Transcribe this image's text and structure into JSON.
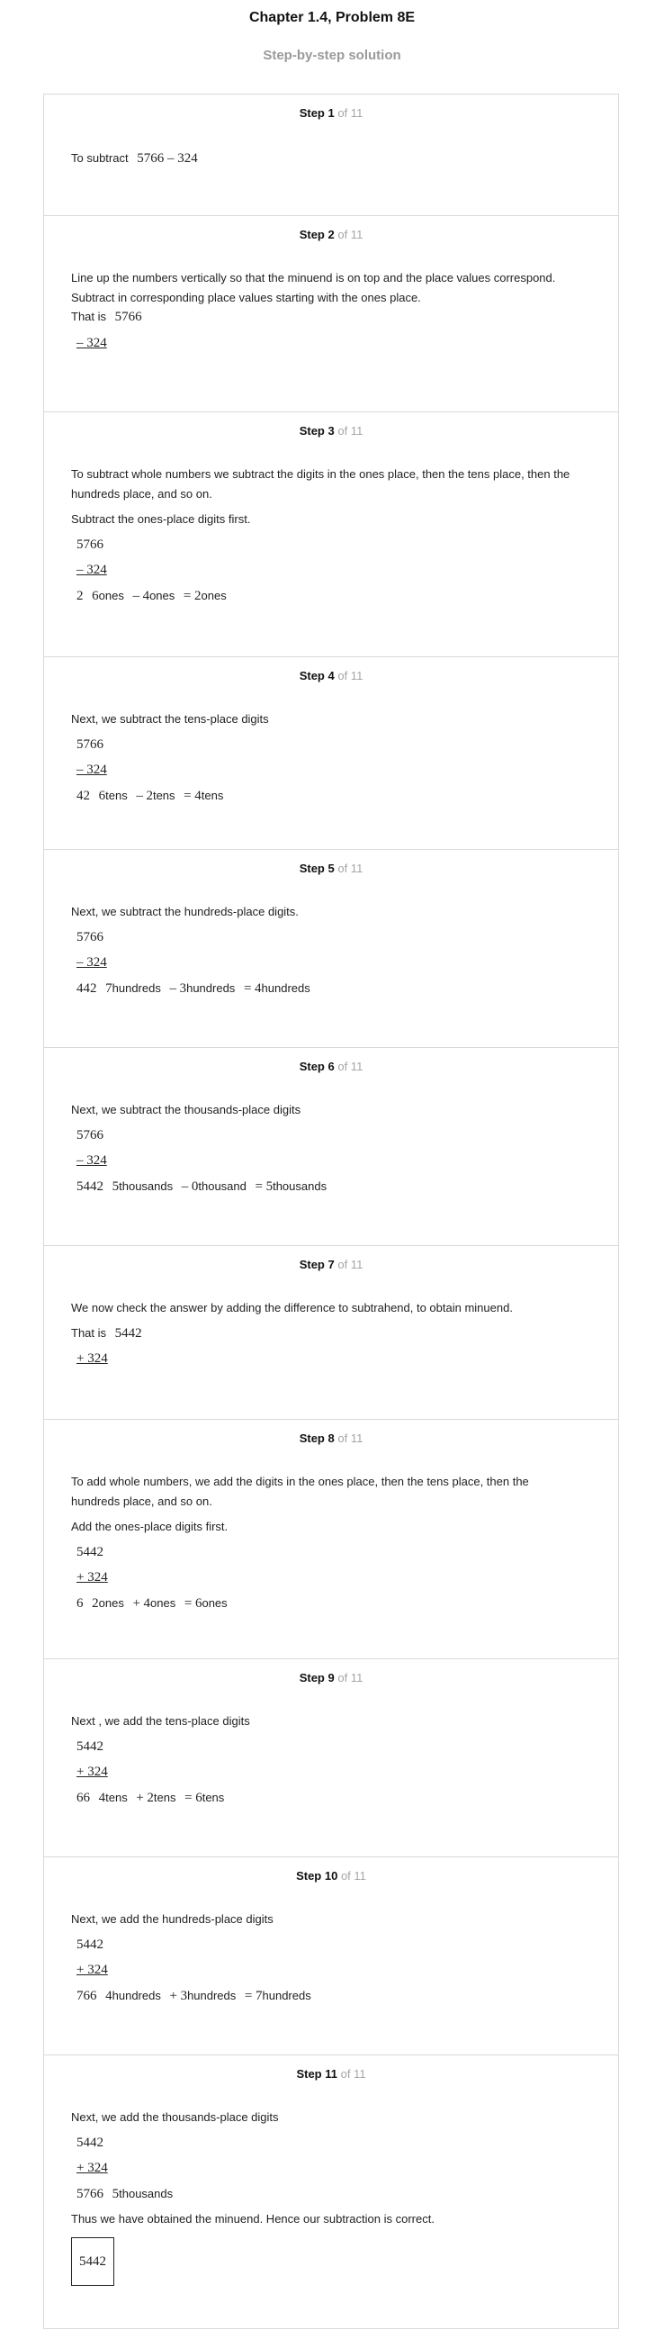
{
  "header": {
    "title": "Chapter 1.4, Problem 8E",
    "subtitle": "Step-by-step solution"
  },
  "steps": [
    {
      "num": "Step 1",
      "of": "of 11",
      "t1": "To subtract",
      "expr": "5766 – 324"
    },
    {
      "num": "Step 2",
      "of": "of 11",
      "t1": "Line up the numbers vertically so that the minuend is on top and the place values correspond. Subtract in corresponding place values starting with the ones place.",
      "t2": "That is",
      "top": "5766",
      "bot": "– 324"
    },
    {
      "num": "Step 3",
      "of": "of 11",
      "t1": "To subtract whole numbers we subtract the digits in the ones place, then the tens place, then the hundreds place, and so on.",
      "t2": "Subtract the ones-place digits first.",
      "top": "5766",
      "bot": "– 324",
      "res": "2",
      "a": "6",
      "au": "ones",
      "op": "–",
      "b": "4",
      "bu": "ones",
      "eq": "=",
      "c": "2",
      "cu": "ones"
    },
    {
      "num": "Step 4",
      "of": "of 11",
      "t1": "Next, we subtract the tens-place digits",
      "top": "5766",
      "bot": "– 324",
      "res": "42",
      "a": "6",
      "au": "tens",
      "op": "–",
      "b": "2",
      "bu": "tens",
      "eq": "=",
      "c": "4",
      "cu": "tens"
    },
    {
      "num": "Step 5",
      "of": "of 11",
      "t1": "Next, we subtract the hundreds-place digits.",
      "top": "5766",
      "bot": "– 324",
      "res": "442",
      "a": "7",
      "au": "hundreds",
      "op": "–",
      "b": "3",
      "bu": "hundreds",
      "eq": "=",
      "c": "4",
      "cu": "hundreds"
    },
    {
      "num": "Step 6",
      "of": "of 11",
      "t1": "Next, we subtract the thousands-place digits",
      "top": "5766",
      "bot": "– 324",
      "res": "5442",
      "a": "5",
      "au": "thousands",
      "op": "–",
      "b": "0",
      "bu": "thousand",
      "eq": "=",
      "c": "5",
      "cu": "thousands"
    },
    {
      "num": "Step 7",
      "of": "of 11",
      "t1": "We now check the answer by adding the difference to subtrahend, to obtain minuend.",
      "t2": "That is",
      "top": "5442",
      "bot": "+ 324"
    },
    {
      "num": "Step 8",
      "of": "of 11",
      "t1": "To add whole numbers, we add the digits in the ones place, then the tens place, then the hundreds place, and so on.",
      "t2": "Add the ones-place digits first.",
      "top": "5442",
      "bot": "+ 324",
      "res": "6",
      "a": "2",
      "au": "ones",
      "op": "+",
      "b": "4",
      "bu": "ones",
      "eq": "=",
      "c": "6",
      "cu": "ones"
    },
    {
      "num": "Step 9",
      "of": "of 11",
      "t1": "Next , we add the tens-place digits",
      "top": "5442",
      "bot": "+ 324",
      "res": "66",
      "a": "4",
      "au": "tens",
      "op": "+",
      "b": "2",
      "bu": "tens",
      "eq": "=",
      "c": "6",
      "cu": "tens"
    },
    {
      "num": "Step 10",
      "of": "of 11",
      "t1": "Next, we add the hundreds-place digits",
      "top": "5442",
      "bot": "+ 324",
      "res": "766",
      "a": "4",
      "au": "hundreds",
      "op": "+",
      "b": "3",
      "bu": "hundreds",
      "eq": "=",
      "c": "7",
      "cu": "hundreds"
    },
    {
      "num": "Step 11",
      "of": "of 11",
      "t1": "Next, we add the thousands-place digits",
      "top": "5442",
      "bot": "+ 324",
      "res": "5766",
      "a": "5",
      "au": "thousands",
      "t2": "Thus we have obtained the minuend. Hence our subtraction is correct.",
      "answer": "5442"
    }
  ]
}
